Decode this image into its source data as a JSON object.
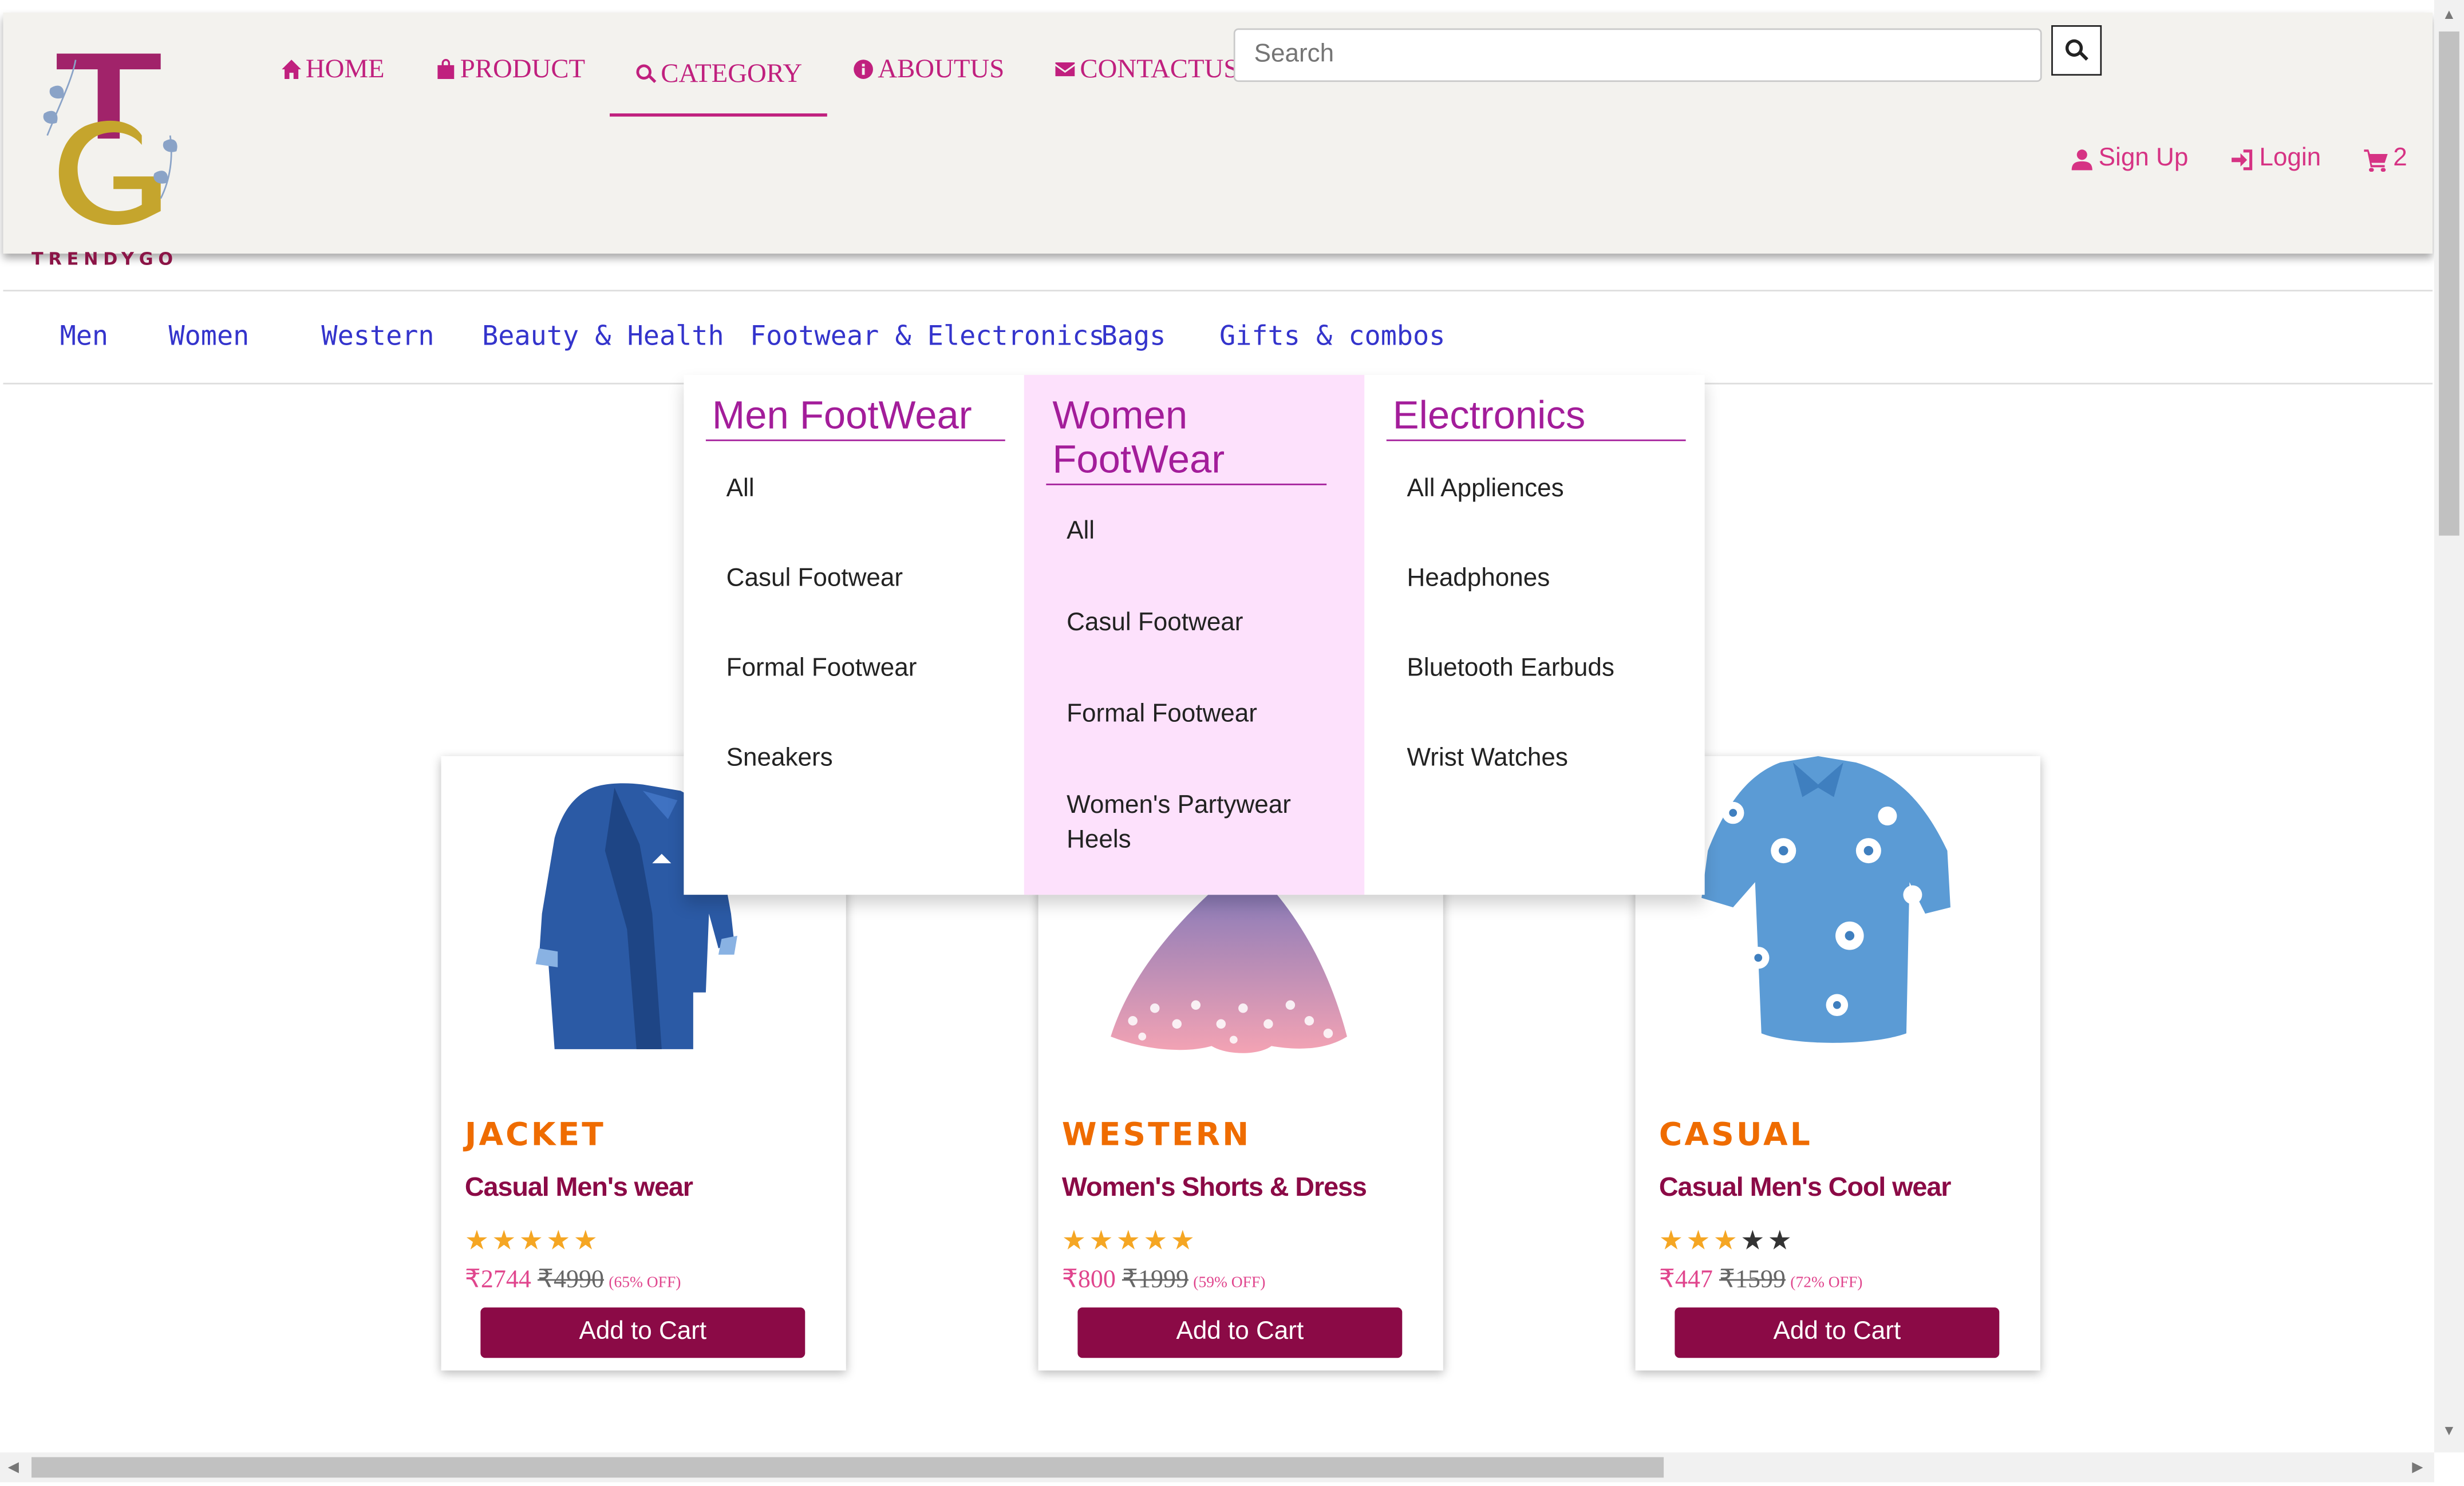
{
  "brand": {
    "logo_letters": "TG",
    "name": "TRENDYGO"
  },
  "nav": {
    "items": [
      {
        "label": "HOME",
        "icon": "home-icon"
      },
      {
        "label": "PRODUCT",
        "icon": "shopping-bag-icon"
      },
      {
        "label": "CATEGORY",
        "icon": "search-icon"
      },
      {
        "label": "ABOUTUS",
        "icon": "info-icon"
      },
      {
        "label": "CONTACTUS",
        "icon": "envelope-icon"
      }
    ],
    "active": "CATEGORY"
  },
  "search": {
    "placeholder": "Search",
    "button_icon": "search-icon"
  },
  "user": {
    "signup": "Sign Up",
    "login": "Login",
    "cart_count": "2"
  },
  "categories": [
    "Men",
    "Women",
    "Western",
    "Beauty & Health",
    "Footwear & Electronics",
    "Bags",
    "Gifts & combos"
  ],
  "dropdown": {
    "columns": [
      {
        "title": "Men FootWear",
        "items": [
          "All",
          "Casul Footwear",
          "Formal Footwear",
          "Sneakers"
        ]
      },
      {
        "title": "Women FootWear",
        "items": [
          "All",
          "Casul Footwear",
          "Formal Footwear",
          "Women's Partywear Heels"
        ]
      },
      {
        "title": "Electronics",
        "items": [
          "All Appliences",
          "Headphones",
          "Bluetooth Earbuds",
          "Wrist Watches"
        ]
      }
    ]
  },
  "products": [
    {
      "category": "JACKET",
      "title": "Casual Men's wear",
      "rating": 5,
      "price": "₹2744",
      "old_price": "₹4990",
      "discount": "(65% OFF)",
      "button": "Add to Cart",
      "image": "blue-jacket"
    },
    {
      "category": "WESTERN",
      "title": "Women's Shorts & Dress",
      "rating": 5,
      "price": "₹800",
      "old_price": "₹1999",
      "discount": "(59% OFF)",
      "button": "Add to Cart",
      "image": "pink-dress"
    },
    {
      "category": "CASUAL",
      "title": "Casual Men's Cool wear",
      "rating": 3,
      "price": "₹447",
      "old_price": "₹1599",
      "discount": "(72% OFF)",
      "button": "Add to Cart",
      "image": "floral-shirt"
    }
  ],
  "colors": {
    "accent": "#c0207e",
    "button": "#8b0a46",
    "dropdown_highlight": "#fde1fc",
    "category_link": "#3434cc"
  }
}
